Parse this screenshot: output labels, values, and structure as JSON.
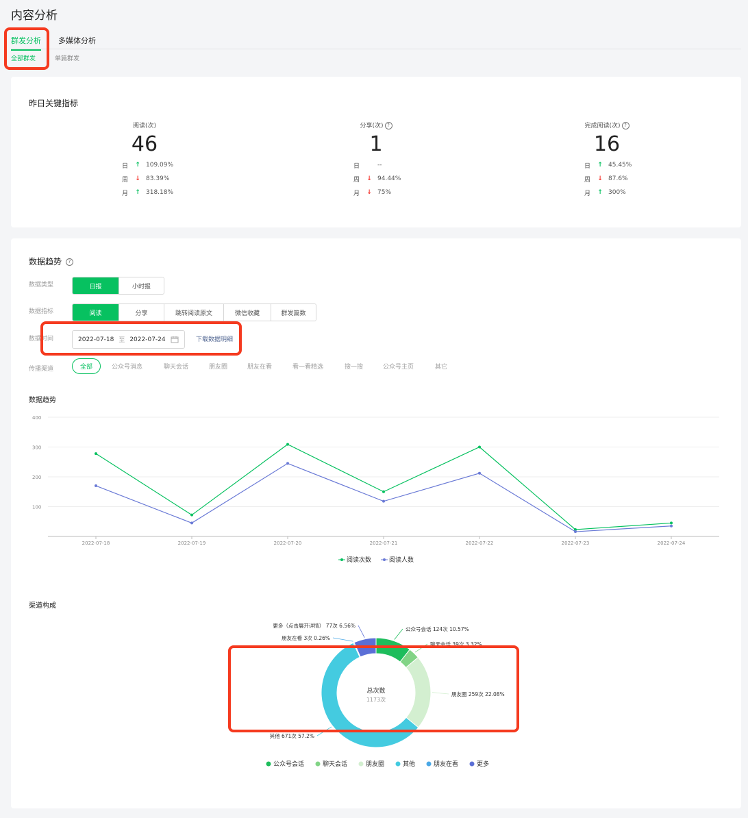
{
  "page": {
    "title": "内容分析"
  },
  "tabs": [
    {
      "label": "群发分析",
      "active": true
    },
    {
      "label": "多媒体分析",
      "active": false
    }
  ],
  "subtabs": [
    {
      "label": "全部群发",
      "active": true
    },
    {
      "label": "单篇群发",
      "active": false
    }
  ],
  "key_metrics": {
    "title": "昨日关键指标",
    "items": [
      {
        "label": "阅读(次)",
        "value": "46",
        "help": false,
        "compare": [
          {
            "label": "日",
            "dir": "up",
            "value": "109.09%"
          },
          {
            "label": "周",
            "dir": "down",
            "value": "83.39%"
          },
          {
            "label": "月",
            "dir": "up",
            "value": "318.18%"
          }
        ]
      },
      {
        "label": "分享(次)",
        "value": "1",
        "help": true,
        "compare": [
          {
            "label": "日",
            "dir": "none",
            "value": "--"
          },
          {
            "label": "周",
            "dir": "down",
            "value": "94.44%"
          },
          {
            "label": "月",
            "dir": "down",
            "value": "75%"
          }
        ]
      },
      {
        "label": "完成阅读(次)",
        "value": "16",
        "help": true,
        "compare": [
          {
            "label": "日",
            "dir": "up",
            "value": "45.45%"
          },
          {
            "label": "周",
            "dir": "down",
            "value": "87.6%"
          },
          {
            "label": "月",
            "dir": "up",
            "value": "300%"
          }
        ]
      }
    ]
  },
  "trend": {
    "title": "数据趋势",
    "data_type": {
      "label": "数据类型",
      "options": [
        "日报",
        "小时报"
      ],
      "selected": "日报"
    },
    "metric": {
      "label": "数据指标",
      "options": [
        "阅读",
        "分享",
        "跳转阅读原文",
        "微信收藏",
        "群发篇数"
      ],
      "selected": "阅读"
    },
    "time": {
      "label": "数据时间",
      "start": "2022-07-18",
      "sep": "至",
      "end": "2022-07-24",
      "download_label": "下载数据明细"
    },
    "channel": {
      "label": "传播渠道",
      "options": [
        "全部",
        "公众号消息",
        "聊天会话",
        "朋友圈",
        "朋友在看",
        "看一看精选",
        "搜一搜",
        "公众号主页",
        "其它"
      ],
      "selected": "全部"
    },
    "chart_title": "数据趋势",
    "pie_title": "渠道构成"
  },
  "chart_data": [
    {
      "type": "line",
      "title": "数据趋势",
      "x": [
        "2022-07-18",
        "2022-07-19",
        "2022-07-20",
        "2022-07-21",
        "2022-07-22",
        "2022-07-23",
        "2022-07-24"
      ],
      "yticks": [
        100,
        200,
        300,
        400
      ],
      "ylim": [
        0,
        400
      ],
      "grid": true,
      "legend": "bottom",
      "series": [
        {
          "name": "阅读次数",
          "color": "#07c160",
          "values": [
            278,
            72,
            309,
            150,
            300,
            23,
            45
          ]
        },
        {
          "name": "阅读人数",
          "color": "#6a7ad6",
          "values": [
            170,
            45,
            245,
            118,
            212,
            16,
            35
          ]
        }
      ]
    },
    {
      "type": "pie",
      "title": "渠道构成",
      "center_label": "总次数",
      "center_value": "1173次",
      "total": 1173,
      "legend": "bottom",
      "slices": [
        {
          "name": "公众号会话",
          "value": 124,
          "percent": 10.57,
          "color": "#1ebd5c",
          "label": "公众号会话 124次 10.57%"
        },
        {
          "name": "聊天会话",
          "value": 39,
          "percent": 3.32,
          "color": "#82d486",
          "label": "聊天会话 39次 3.32%"
        },
        {
          "name": "朋友圈",
          "value": 259,
          "percent": 22.08,
          "color": "#d3efd0",
          "label": "朋友圈 259次 22.08%"
        },
        {
          "name": "其他",
          "value": 671,
          "percent": 57.2,
          "color": "#44cbe0",
          "label": "其他 671次 57.2%"
        },
        {
          "name": "朋友在看",
          "value": 3,
          "percent": 0.26,
          "color": "#4aa8e6",
          "label": "朋友在看 3次 0.26%"
        },
        {
          "name": "更多",
          "value": 77,
          "percent": 6.56,
          "color": "#5b6fd6",
          "label": "更多（点击展开详情） 77次 6.56%"
        }
      ]
    }
  ]
}
